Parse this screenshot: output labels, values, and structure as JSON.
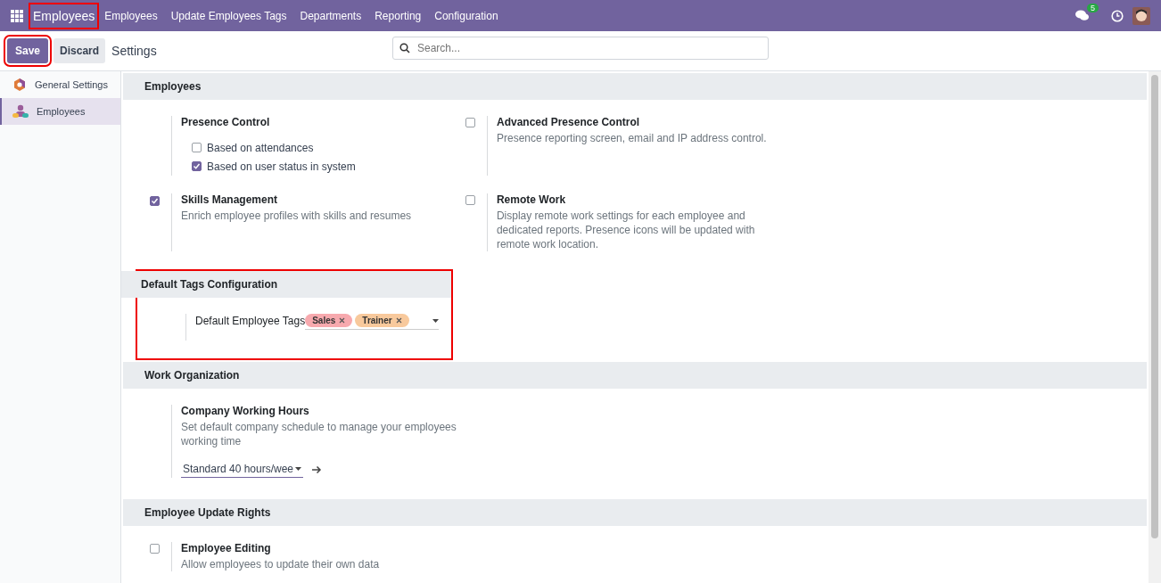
{
  "navbar": {
    "app_name": "Employees",
    "app_highlighted": true,
    "menu": [
      "Employees",
      "Update Employees Tags",
      "Departments",
      "Reporting",
      "Configuration"
    ],
    "chat_count": "5"
  },
  "control_panel": {
    "save": "Save",
    "save_highlighted": true,
    "discard": "Discard",
    "title": "Settings",
    "search_placeholder": "Search..."
  },
  "sidebar": {
    "items": [
      {
        "label": "General Settings",
        "kind": "general",
        "selected": false
      },
      {
        "label": "Employees",
        "kind": "employees",
        "selected": true
      }
    ]
  },
  "sections": [
    {
      "title": "Employees",
      "highlighted": false,
      "settings": [
        {
          "kind": "options",
          "title": "Presence Control",
          "options": [
            {
              "label": "Based on attendances",
              "checked": false
            },
            {
              "label": "Based on user status in system",
              "checked": true
            }
          ]
        },
        {
          "kind": "toggle",
          "title": "Advanced Presence Control",
          "checked": false,
          "description": "Presence reporting screen, email and IP address control."
        },
        {
          "kind": "toggle",
          "title": "Skills Management",
          "checked": true,
          "description": "Enrich employee profiles with skills and resumes"
        },
        {
          "kind": "toggle",
          "title": "Remote Work",
          "checked": false,
          "description": "Display remote work settings for each employee and dedicated reports. Presence icons will be updated with remote work location."
        }
      ]
    },
    {
      "title": "Default Tags Configuration",
      "highlighted": true,
      "settings": [
        {
          "kind": "tags",
          "title": "Default Employee Tags",
          "tags": [
            {
              "label": "Sales",
              "color": "#f7a9ae"
            },
            {
              "label": "Trainer",
              "color": "#f8c99c"
            }
          ]
        }
      ]
    },
    {
      "title": "Work Organization",
      "highlighted": false,
      "settings": [
        {
          "kind": "select",
          "title": "Company Working Hours",
          "description": "Set default company schedule to manage your employees working time",
          "value": "Standard 40 hours/wee"
        }
      ]
    },
    {
      "title": "Employee Update Rights",
      "highlighted": false,
      "settings": [
        {
          "kind": "toggle",
          "title": "Employee Editing",
          "checked": false,
          "description": "Allow employees to update their own data"
        }
      ]
    }
  ]
}
